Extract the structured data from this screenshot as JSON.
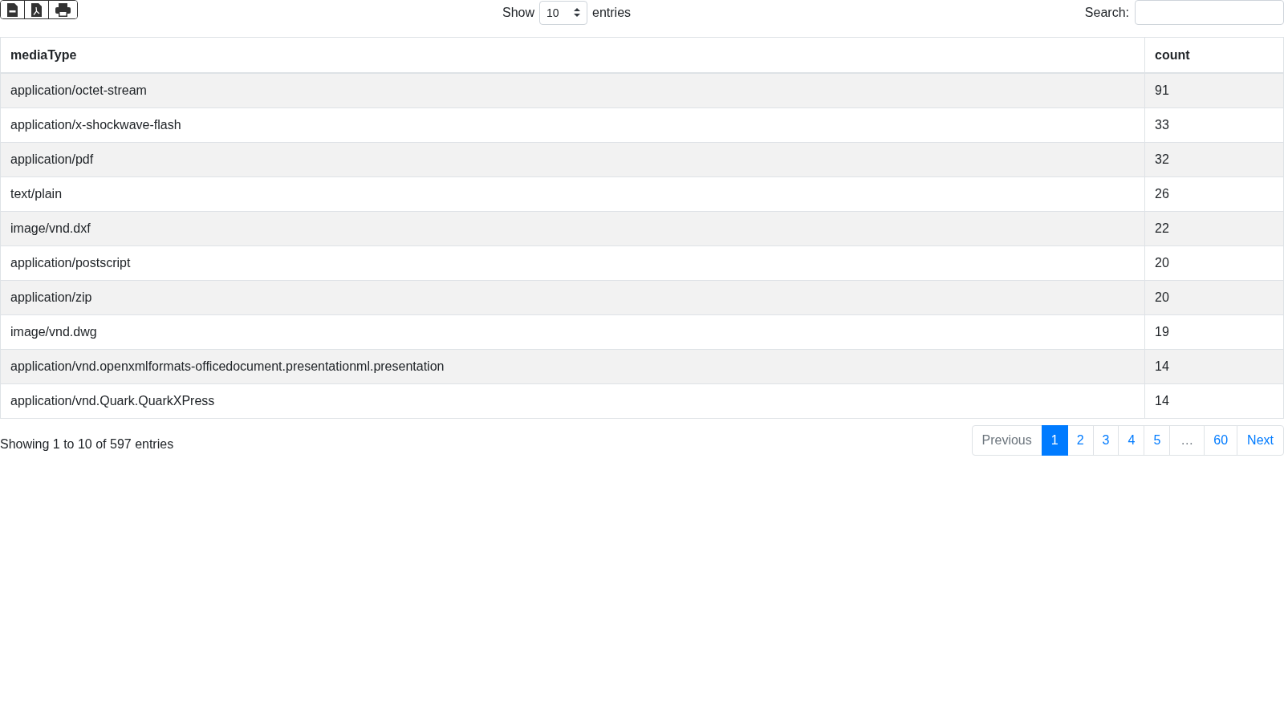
{
  "toolbar": {
    "export_buttons": [
      {
        "kind": "csv"
      },
      {
        "kind": "pdf"
      },
      {
        "kind": "print"
      }
    ],
    "length": {
      "label_before": "Show",
      "value": "10",
      "label_after": "entries"
    },
    "search": {
      "label": "Search:"
    }
  },
  "table": {
    "columns": [
      "mediaType",
      "count"
    ],
    "rows": [
      [
        "application/octet-stream",
        "91"
      ],
      [
        "application/x-shockwave-flash",
        "33"
      ],
      [
        "application/pdf",
        "32"
      ],
      [
        "text/plain",
        "26"
      ],
      [
        "image/vnd.dxf",
        "22"
      ],
      [
        "application/postscript",
        "20"
      ],
      [
        "application/zip",
        "20"
      ],
      [
        "image/vnd.dwg",
        "19"
      ],
      [
        "application/vnd.openxmlformats-officedocument.presentationml.presentation",
        "14"
      ],
      [
        "application/vnd.Quark.QuarkXPress",
        "14"
      ]
    ]
  },
  "info": "Showing 1 to 10 of 597 entries",
  "pagination": [
    {
      "label": "Previous",
      "kind": "nav",
      "selected": false,
      "disabled": true
    },
    {
      "label": "1",
      "kind": "page",
      "selected": true,
      "disabled": false
    },
    {
      "label": "2",
      "kind": "page",
      "selected": false,
      "disabled": false
    },
    {
      "label": "3",
      "kind": "page",
      "selected": false,
      "disabled": false
    },
    {
      "label": "4",
      "kind": "page",
      "selected": false,
      "disabled": false
    },
    {
      "label": "5",
      "kind": "page",
      "selected": false,
      "disabled": false
    },
    {
      "label": "…",
      "kind": "ellipsis",
      "selected": false,
      "disabled": true
    },
    {
      "label": "60",
      "kind": "page",
      "selected": false,
      "disabled": false
    },
    {
      "label": "Next",
      "kind": "nav",
      "selected": false,
      "disabled": false
    }
  ]
}
